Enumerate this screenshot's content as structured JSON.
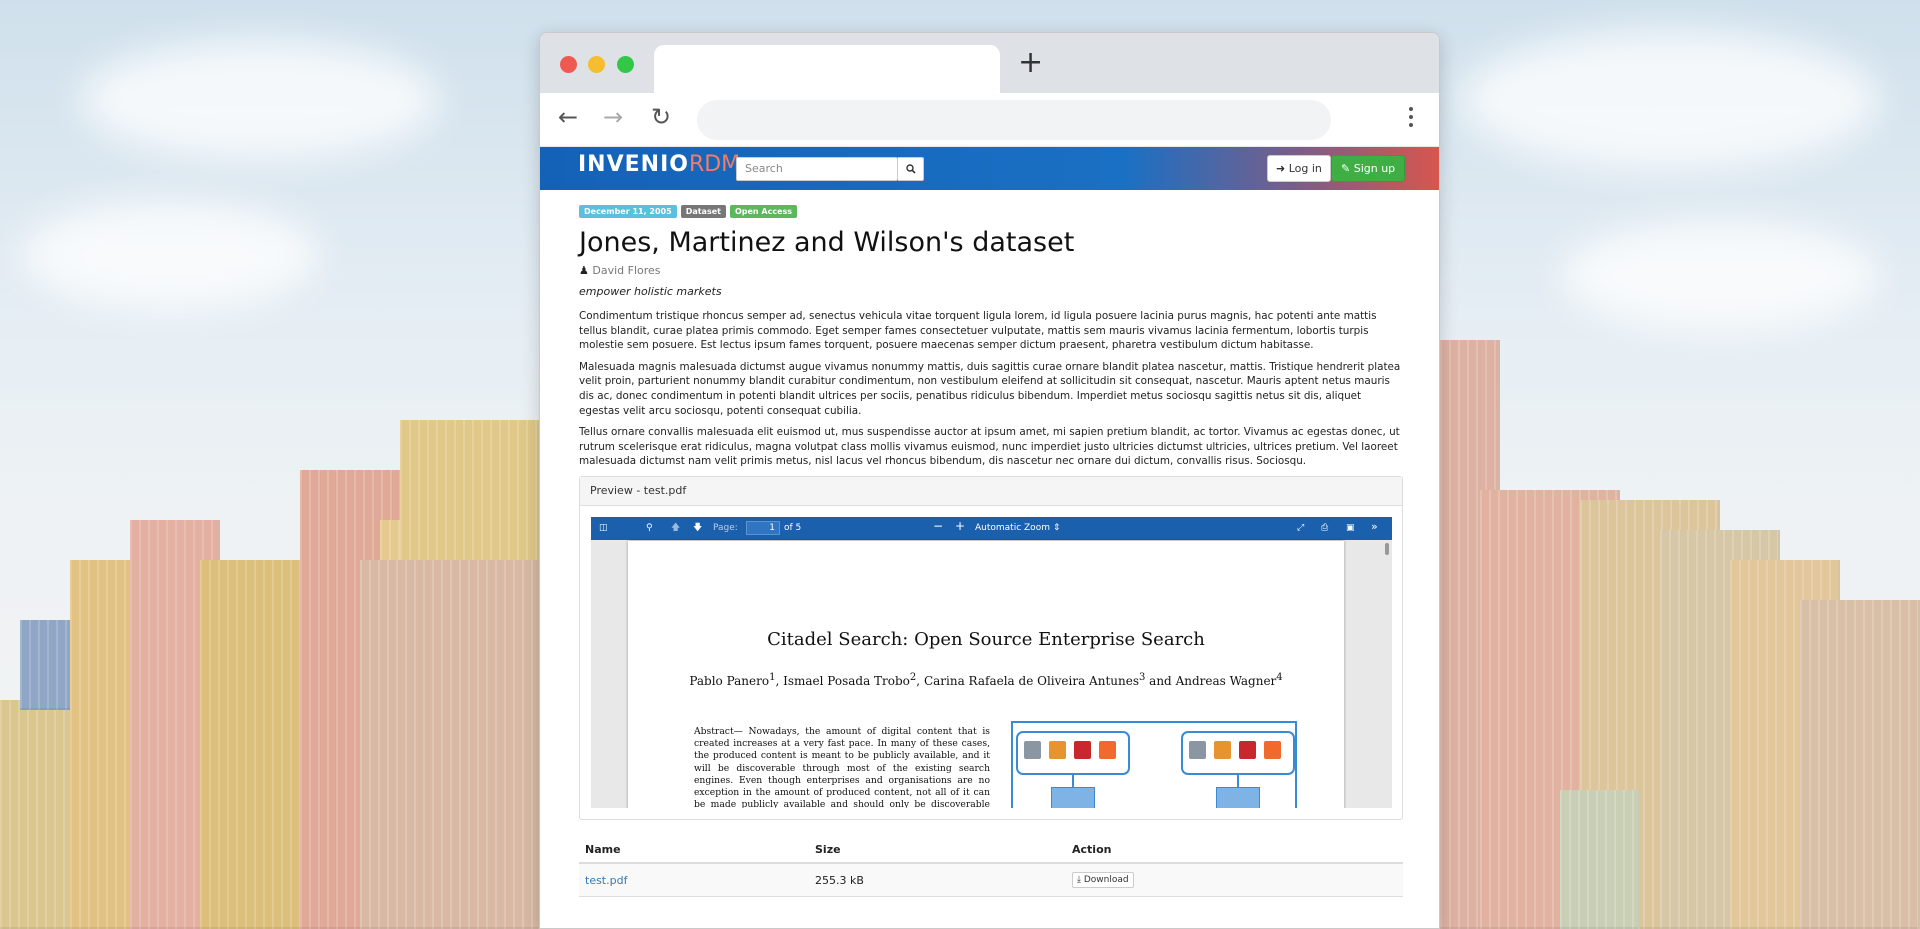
{
  "header": {
    "logo_main": "INVENIO",
    "logo_rdm": "RDM",
    "search_placeholder": "Search",
    "login_label": "Log in",
    "signup_label": "Sign up"
  },
  "record": {
    "badges": {
      "date": "December 11, 2005",
      "type": "Dataset",
      "access": "Open Access"
    },
    "title": "Jones, Martinez and Wilson's dataset",
    "creator": "David Flores",
    "subtitle": "empower holistic markets",
    "description": [
      "Condimentum tristique rhoncus semper ad, senectus vehicula vitae torquent ligula lorem, id ligula posuere lacinia purus magnis, hac potenti ante mattis tellus blandit, curae platea primis commodo. Eget semper fames consectetuer vulputate, mattis sem mauris vivamus lacinia fermentum, lobortis turpis molestie sem posuere. Est lectus ipsum fames torquent, posuere maecenas semper dictum praesent, pharetra vestibulum dictum habitasse.",
      "Malesuada magnis malesuada dictumst augue vivamus nonummy mattis, duis sagittis curae ornare blandit platea nascetur, mattis. Tristique hendrerit platea velit proin, parturient nonummy blandit curabitur condimentum, non vestibulum eleifend at sollicitudin sit consequat, nascetur. Mauris aptent netus mauris dis ac, donec condimentum in potenti blandit ultrices per sociis, penatibus ridiculus bibendum. Imperdiet metus sociosqu sagittis netus sit dis, aliquet egestas velit arcu sociosqu, potenti consequat cubilia.",
      "Tellus ornare convallis malesuada elit euismod ut, mus suspendisse auctor at ipsum amet, mi sapien pretium blandit, ac tortor. Vivamus ac egestas donec, ut rutrum scelerisque erat ridiculus, magna volutpat class mollis vivamus euismod, nunc imperdiet justo ultricies dictumst ultricies, ultrices pretium. Vel laoreet malesuada dictumst nam velit primis metus, nisl lacus vel rhoncus bibendum, dis nascetur nec ornare dui dictum, convallis risus. Sociosqu."
    ]
  },
  "preview": {
    "heading": "Preview - test.pdf",
    "toolbar": {
      "page_label": "Page:",
      "page_value": "1",
      "page_total": "of 5",
      "zoom_label": "Automatic Zoom"
    },
    "pdf": {
      "title": "Citadel Search: Open Source Enterprise Search",
      "authors": [
        {
          "name": "Pablo Panero",
          "sup": "1"
        },
        {
          "name": "Ismael Posada Trobo",
          "sup": "2"
        },
        {
          "name": "Carina Rafaela de Oliveira Antunes",
          "sup": "3"
        },
        {
          "name": "Andreas Wagner",
          "sup": "4"
        }
      ],
      "abstract": "Abstract— Nowadays, the amount of digital content that is created increases at a very fast pace. In many of these cases, the produced content is meant to be publicly available, and it will be discoverable through most of the existing search engines. Even though enterprises and organisations are no exception in the amount of produced content, not all of it can be made publicly available and should only be discoverable and accessible"
    }
  },
  "files": {
    "columns": [
      "Name",
      "Size",
      "Action"
    ],
    "rows": [
      {
        "name": "test.pdf",
        "size": "255.3 kB",
        "action": "Download"
      }
    ]
  },
  "colors": {
    "header_blue": "#1462b8",
    "signup_green": "#3fae44",
    "viewer_blue": "#1b60ad",
    "link_blue": "#337ab7"
  }
}
